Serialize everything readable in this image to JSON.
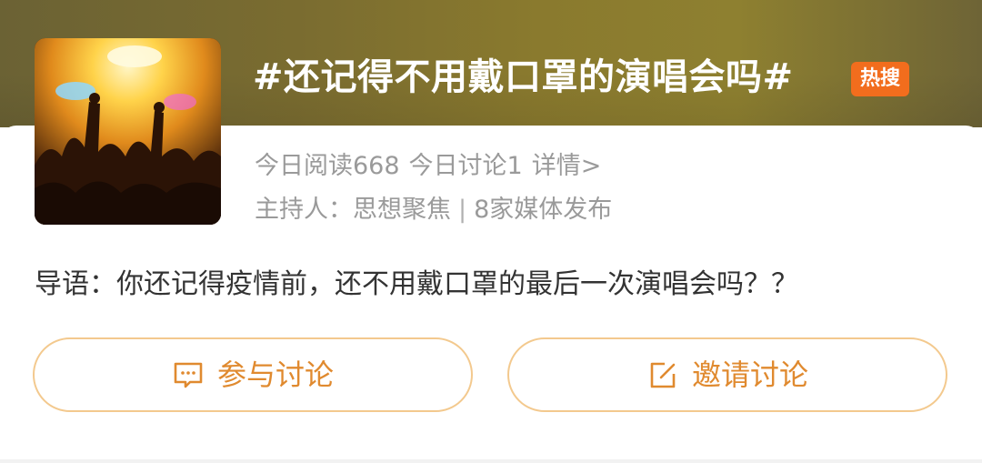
{
  "topic": {
    "title": "#还记得不用戴口罩的演唱会吗#",
    "badge": "热搜",
    "cover_image": "concert-crowd-photo"
  },
  "stats": {
    "read": "今日阅读668",
    "discuss": "今日讨论1",
    "details_link": "详情>"
  },
  "host": {
    "prefix": "主持人：",
    "name": "思想聚焦",
    "separator": "|",
    "media": "8家媒体发布"
  },
  "intro": {
    "text": "导语：你还记得疫情前，还不用戴口罩的最后一次演唱会吗？？"
  },
  "actions": {
    "join": {
      "label": "参与讨论",
      "icon": "comment-icon"
    },
    "invite": {
      "label": "邀请讨论",
      "icon": "edit-icon"
    }
  },
  "colors": {
    "header_band": "#7d6f31",
    "badge": "#f26d1d",
    "button_border": "#f3c98e",
    "button_text": "#e08a2f",
    "muted_text": "#9a9a9a"
  }
}
